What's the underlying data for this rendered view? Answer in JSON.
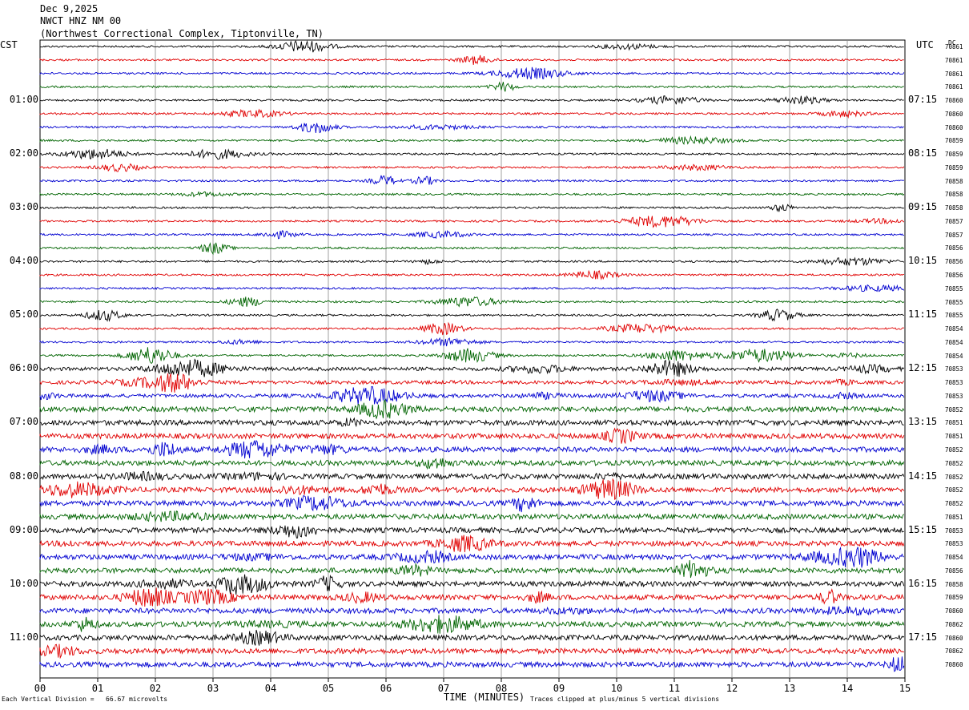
{
  "header": {
    "date": "Dec 9,2025",
    "station": "NWCT HNZ NM 00",
    "location": "(Northwest Correctional Complex, Tiptonville, TN)"
  },
  "left_tz": "CST",
  "right_tz": "UTC",
  "dc_header": "DC",
  "chart_data": {
    "type": "line",
    "subtype": "helicorder",
    "title": "Dec 9,2025",
    "xlabel": "TIME (MINUTES)",
    "xlim": [
      0,
      15
    ],
    "x_ticks": [
      "00",
      "01",
      "02",
      "03",
      "04",
      "05",
      "06",
      "07",
      "08",
      "09",
      "10",
      "11",
      "12",
      "13",
      "14",
      "15"
    ],
    "trace_colors": [
      "#000000",
      "#e00000",
      "#0000d0",
      "#006400"
    ],
    "left_times": [
      "01:00",
      "02:00",
      "03:00",
      "04:00",
      "05:00",
      "06:00",
      "07:00",
      "08:00",
      "09:00",
      "10:00",
      "11:00"
    ],
    "right_times": [
      "07:15",
      "08:15",
      "09:15",
      "10:15",
      "11:15",
      "12:15",
      "13:15",
      "14:15",
      "15:15",
      "16:15",
      "17:15"
    ],
    "dc_offsets": [
      "70861",
      "70861",
      "70861",
      "70861",
      "70860",
      "70860",
      "70860",
      "70859",
      "70859",
      "70859",
      "70858",
      "70858",
      "70858",
      "70857",
      "70857",
      "70856",
      "70856",
      "70856",
      "70855",
      "70855",
      "70855",
      "70854",
      "70854",
      "70854",
      "70853",
      "70853",
      "70853",
      "70852",
      "70851",
      "70851",
      "70852",
      "70852",
      "70852",
      "70852",
      "70852",
      "70851",
      "70853",
      "70853",
      "70854",
      "70856",
      "70858",
      "70859",
      "70860",
      "70862",
      "70860",
      "70862",
      "70860"
    ],
    "scale_note": "Each Vertical Division =   66.67 microvolts",
    "clip_note": "Traces clipped at plus/minus 5 vertical divisions"
  }
}
